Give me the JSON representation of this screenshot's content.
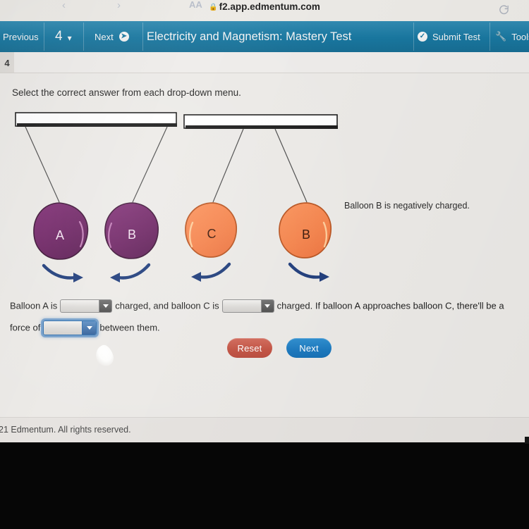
{
  "browser": {
    "url": "f2.app.edmentum.com",
    "lock_icon": "lock-icon",
    "back_icon": "back-arrow-icon",
    "forward_icon": "forward-arrow-icon",
    "text_size_label": "AA",
    "reload_icon": "reload-icon"
  },
  "appnav": {
    "previous_label": "Previous",
    "question_number": "4",
    "next_label": "Next",
    "title": "Electricity and Magnetism: Mastery Test",
    "submit_label": "Submit Test",
    "tools_label": "Tools",
    "bar_color": "#1a7da8"
  },
  "question": {
    "number": "4",
    "instruction": "Select the correct answer from each drop-down menu.",
    "side_note": "Balloon B is negatively charged."
  },
  "diagram": {
    "type": "two-balloon-pair-illustration",
    "colors": {
      "purple_balloon": "#6b2161",
      "orange_balloon": "#f5824a",
      "arrow": "#1d3b7a",
      "bar_fill": "#ffffff",
      "bar_stroke": "#1a1a1a",
      "string": "#4a4a4a"
    },
    "pairs": [
      {
        "name": "left-pair",
        "balloons": [
          {
            "label": "A",
            "color": "purple",
            "arrow_direction": "right"
          },
          {
            "label": "B",
            "color": "purple",
            "arrow_direction": "left"
          }
        ],
        "interaction": "attraction"
      },
      {
        "name": "right-pair",
        "balloons": [
          {
            "label": "C",
            "color": "orange",
            "arrow_direction": "left"
          },
          {
            "label": "B",
            "color": "orange",
            "arrow_direction": "right"
          }
        ],
        "interaction": "repulsion"
      }
    ]
  },
  "sentence": {
    "part1": "Balloon A is",
    "dropdown1_value": "",
    "part2": "charged, and balloon C is",
    "dropdown2_value": "",
    "part3": "charged. If balloon A approaches balloon C, there'll be a force of",
    "dropdown3_value": "",
    "part4": "between them."
  },
  "actions": {
    "reset_label": "Reset",
    "reset_color": "#c25141",
    "next_label": "Next",
    "next_color": "#1b79bf"
  },
  "footer": {
    "copyright": "21 Edmentum. All rights reserved."
  }
}
